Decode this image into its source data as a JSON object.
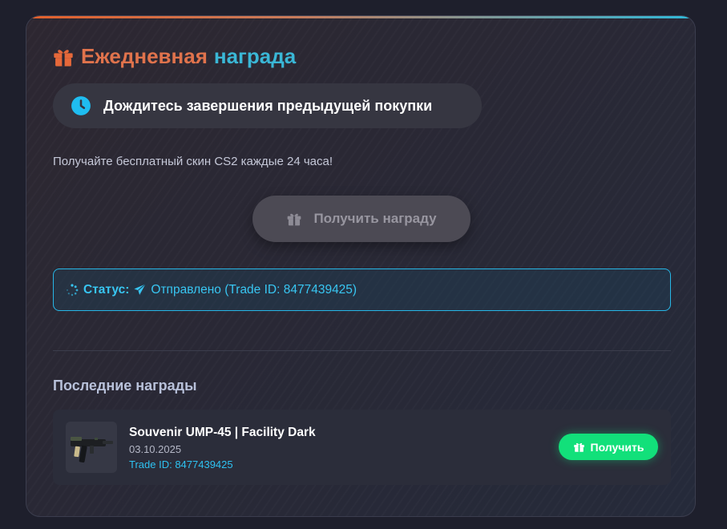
{
  "header": {
    "title_part1": "Ежедневная",
    "title_part2": "награда",
    "icon": "gift-icon"
  },
  "notice": {
    "icon": "clock-icon",
    "text": "Дождитесь завершения предыдущей покупки"
  },
  "subtitle": "Получайте бесплатный скин CS2 каждые 24 часа!",
  "claim_button": {
    "label": "Получить награду",
    "icon": "gift-icon",
    "disabled": true
  },
  "status": {
    "label": "Статус:",
    "value": "Отправлено (Trade ID: 8477439425)",
    "icons": [
      "spinner-icon",
      "paper-plane-icon"
    ]
  },
  "recent": {
    "title": "Последние награды",
    "items": [
      {
        "name": "Souvenir UMP-45 | Facility Dark",
        "date": "03.10.2025",
        "trade": "Trade ID: 8477439425",
        "button_label": "Получить",
        "button_icon": "gift-icon"
      }
    ]
  },
  "colors": {
    "accent_orange": "#e0734c",
    "accent_cyan": "#3ab7d6",
    "status_blue": "#38c6f2",
    "success_green": "#12e07a"
  }
}
